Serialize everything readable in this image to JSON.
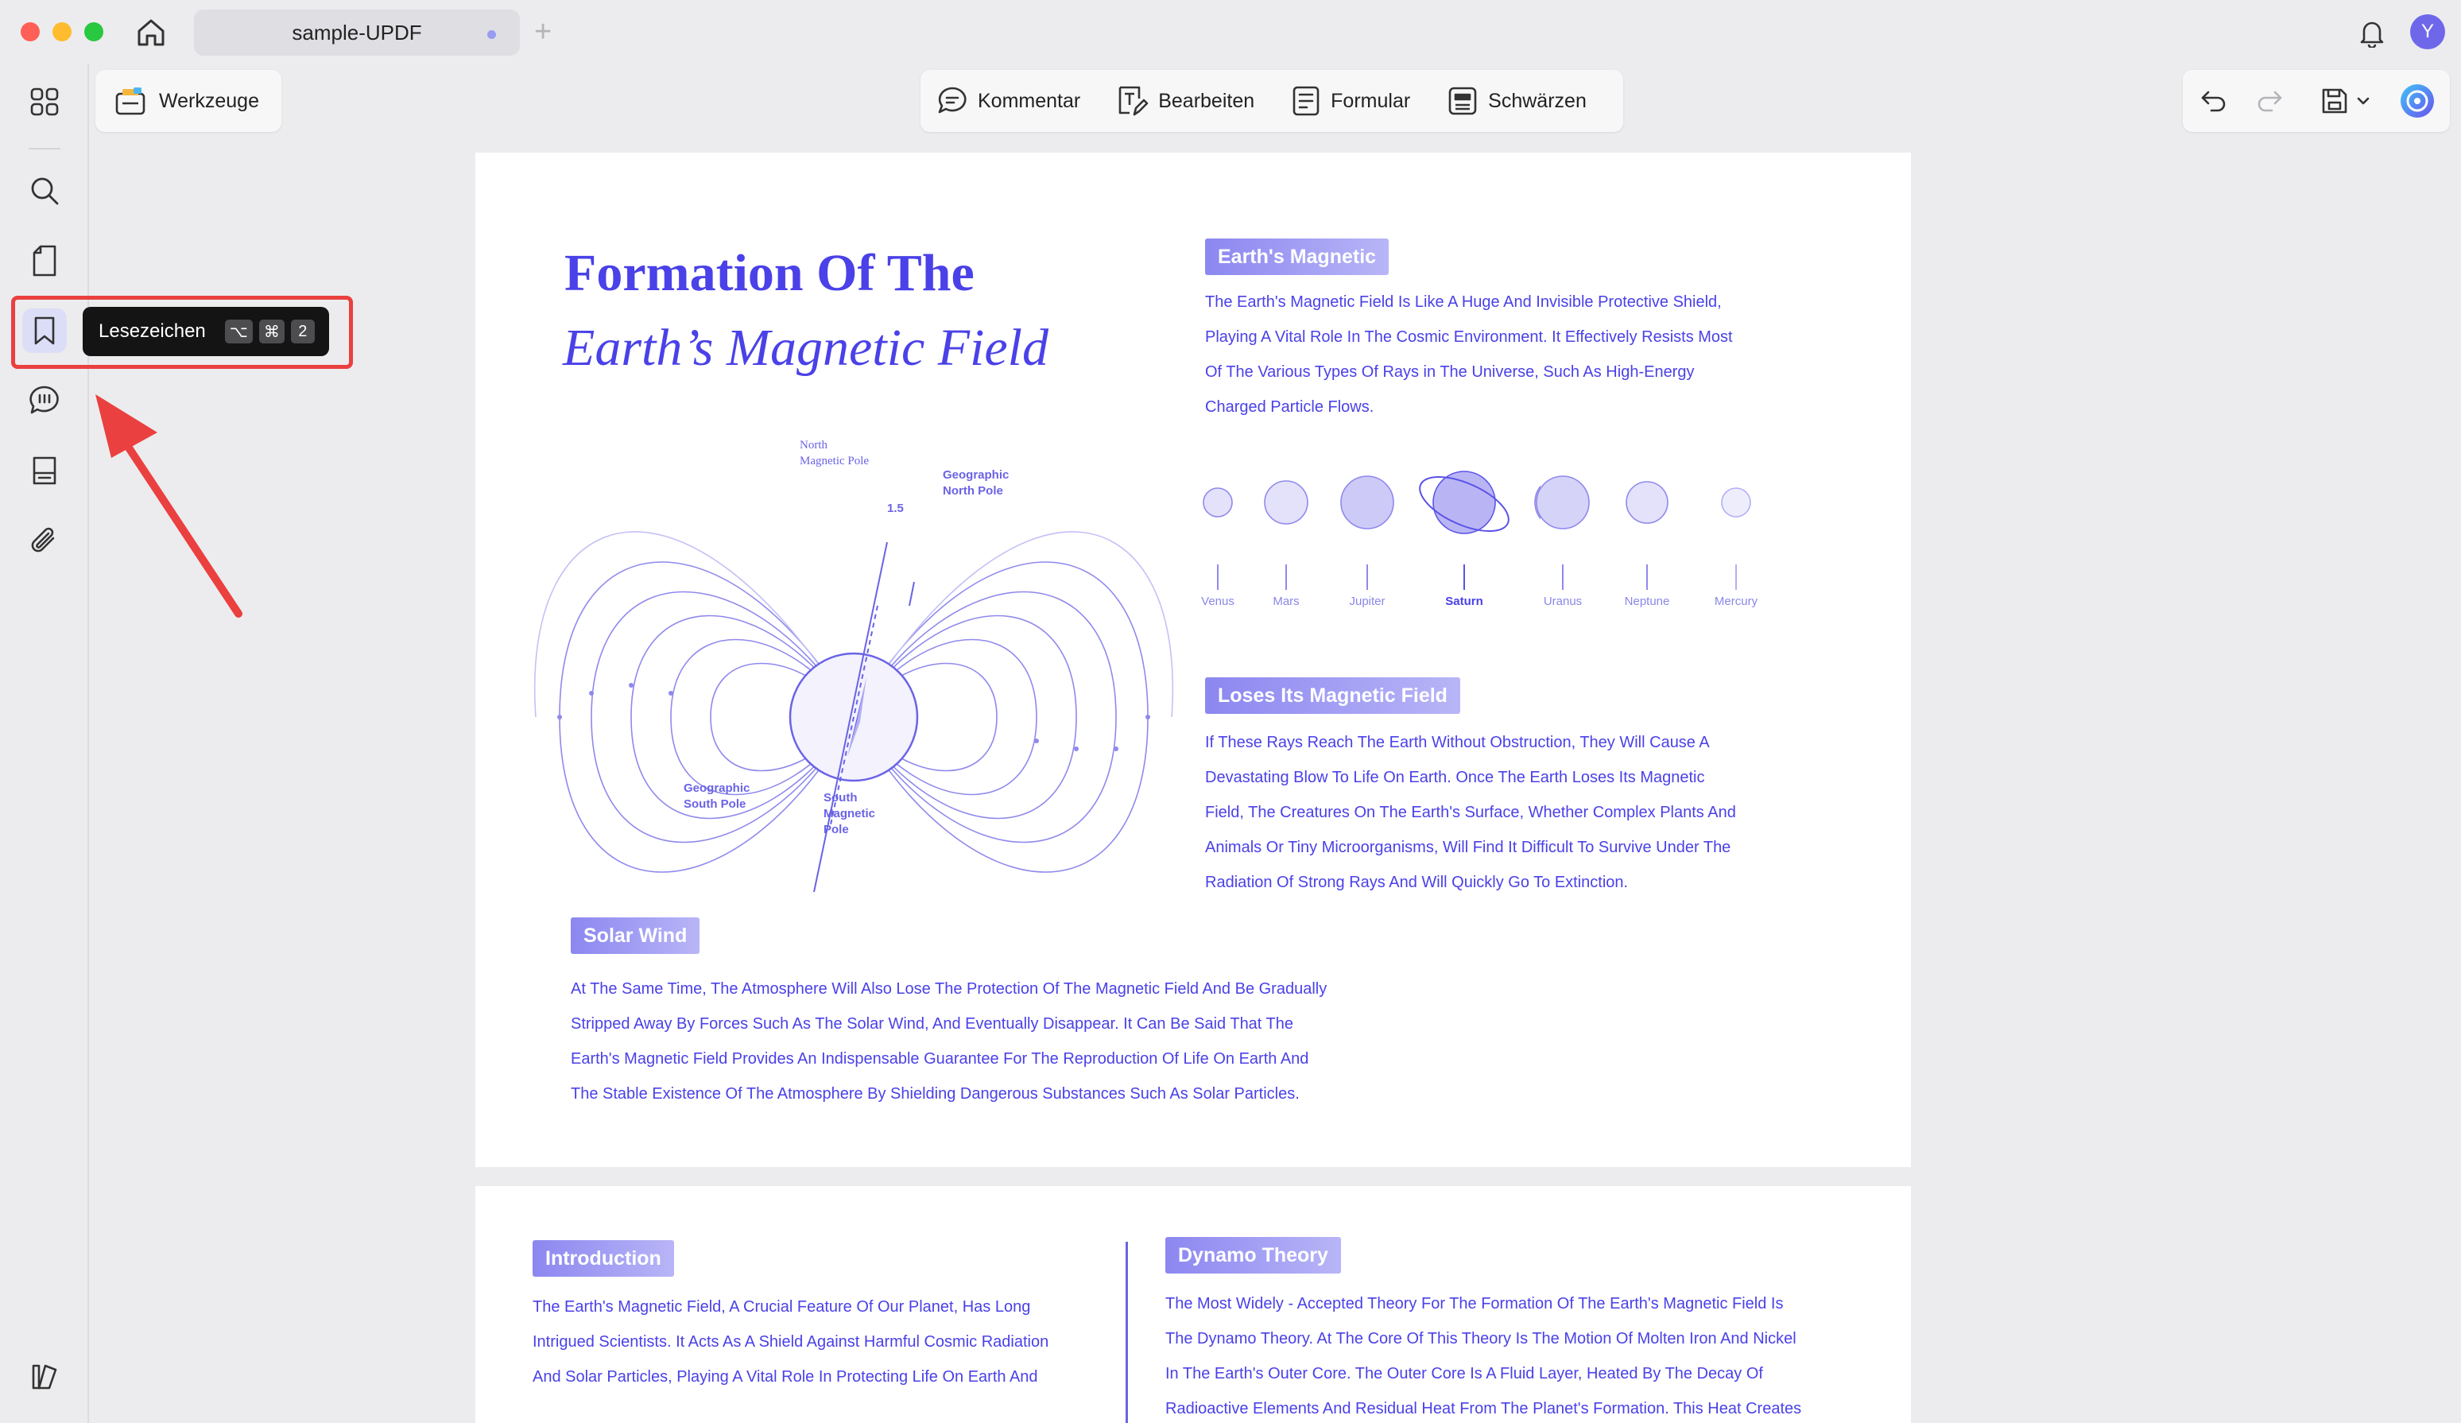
{
  "window": {
    "tab_title": "sample-UPDF",
    "new_tab": "+",
    "avatar_initial": "Y"
  },
  "sidebar": {
    "tooltip": {
      "label": "Lesezeichen",
      "keys": [
        "⌥",
        "⌘",
        "2"
      ]
    },
    "items": [
      {
        "name": "thumbnails",
        "icon": "grid-icon"
      },
      {
        "name": "search",
        "icon": "search-icon"
      },
      {
        "name": "pages",
        "icon": "page-icon"
      },
      {
        "name": "bookmarks",
        "icon": "bookmark-icon",
        "active": true
      },
      {
        "name": "comments",
        "icon": "comment-icon"
      },
      {
        "name": "stamps",
        "icon": "stamp-icon"
      },
      {
        "name": "attachments",
        "icon": "paperclip-icon"
      }
    ]
  },
  "toolbar": {
    "tools_label": "Werkzeuge",
    "comment_label": "Kommentar",
    "edit_label": "Bearbeiten",
    "form_label": "Formular",
    "redact_label": "Schwärzen"
  },
  "document": {
    "page1": {
      "title_line1": "Formation Of The",
      "title_line2": "Earth’s Magnetic Field",
      "diagram": {
        "north_magnetic_pole": [
          "North",
          "Magnetic Pole"
        ],
        "angle": "1.5",
        "geographic_north": [
          "Geographic",
          "North Pole"
        ],
        "geographic_south": [
          "Geographic",
          "South Pole"
        ],
        "south_magnetic_pole": [
          "South",
          "Magnetic",
          "Pole"
        ]
      },
      "earths_magnetic": {
        "heading": "Earth's Magnetic",
        "lines": [
          "The Earth's Magnetic Field Is Like A Huge And Invisible Protective Shield,",
          "Playing A Vital Role In The Cosmic Environment. It Effectively Resists Most",
          "Of The Various Types Of Rays in The Universe, Such As High-Energy",
          "Charged Particle Flows."
        ]
      },
      "planets": [
        "Venus",
        "Mars",
        "Jupiter",
        "Saturn",
        "Uranus",
        "Neptune",
        "Mercury"
      ],
      "loses_field": {
        "heading": "Loses Its Magnetic Field",
        "lines": [
          "If These Rays Reach The Earth Without Obstruction, They Will Cause A",
          "Devastating Blow To Life On Earth. Once The Earth Loses Its Magnetic",
          "Field, The Creatures On The Earth's Surface, Whether Complex Plants And",
          "Animals Or Tiny Microorganisms, Will Find It Difficult To Survive Under The",
          "Radiation Of Strong Rays And Will Quickly Go To Extinction."
        ]
      },
      "solar_wind": {
        "heading": "Solar Wind",
        "lines": [
          "At The Same Time, The Atmosphere Will Also Lose The Protection Of The Magnetic Field And Be Gradually",
          "Stripped Away By Forces Such As The Solar Wind, And Eventually Disappear. It Can Be Said That The",
          "Earth's Magnetic Field Provides An Indispensable Guarantee For The Reproduction Of Life On Earth And",
          "The Stable Existence Of The Atmosphere By Shielding Dangerous Substances Such As Solar Particles."
        ]
      }
    },
    "page2": {
      "introduction": {
        "heading": "Introduction",
        "lines": [
          "The Earth's Magnetic Field, A Crucial Feature Of Our Planet, Has Long",
          "Intrigued Scientists. It Acts As A Shield Against Harmful Cosmic Radiation",
          "And Solar Particles, Playing A Vital Role In Protecting Life On Earth And"
        ]
      },
      "dynamo": {
        "heading": "Dynamo Theory",
        "lines": [
          "The Most Widely - Accepted Theory For The Formation Of The Earth's Magnetic Field Is",
          "The Dynamo Theory. At The Core Of This Theory Is The Motion Of Molten Iron And Nickel",
          "In The Earth's Outer Core. The Outer Core Is A Fluid Layer, Heated By The Decay Of",
          "Radioactive Elements And Residual Heat From The Planet's Formation. This Heat Creates"
        ]
      }
    }
  },
  "colors": {
    "accent": "#4a41e8",
    "highlight": "#ea4040",
    "tooltip_bg": "#141414"
  }
}
